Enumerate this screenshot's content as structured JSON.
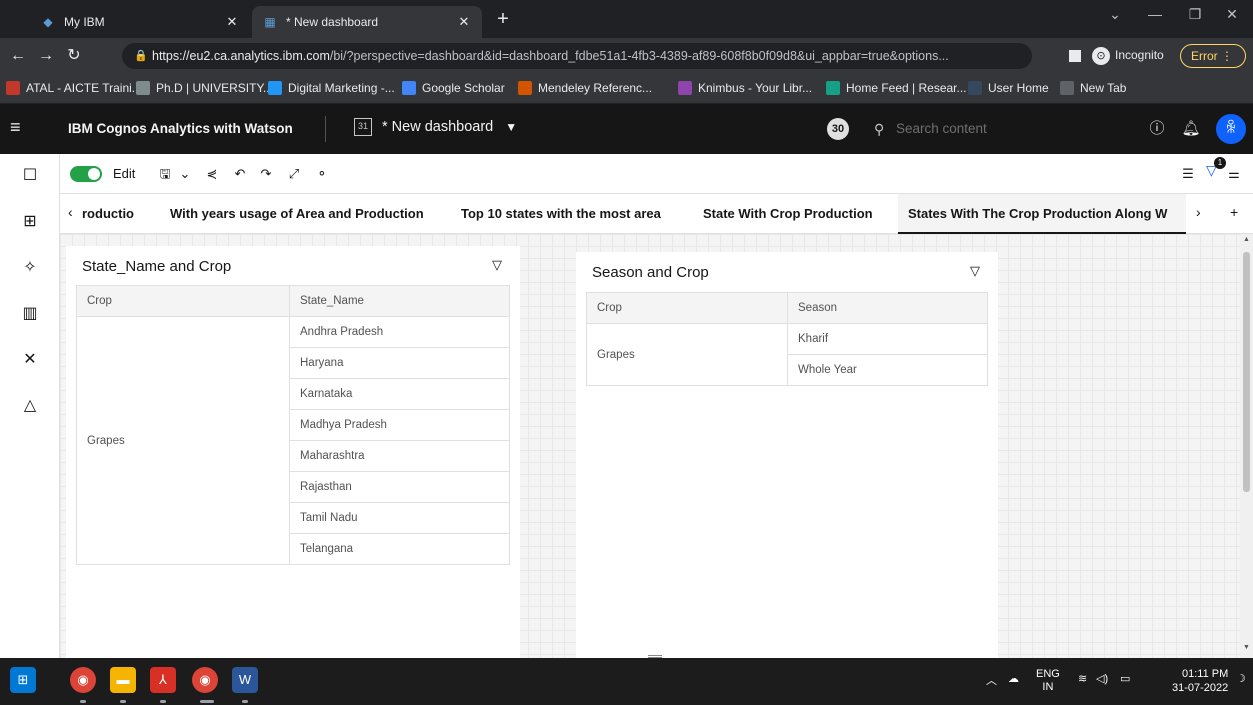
{
  "browser": {
    "tabs": [
      {
        "title": "My IBM",
        "active": false
      },
      {
        "title": "* New dashboard",
        "active": true
      }
    ],
    "new_tab_label": "+",
    "url_host": "https://eu2.ca.analytics.ibm.com",
    "url_rest": "/bi/?perspective=dashboard&id=dashboard_fdbe51a1-4fb3-4389-af89-608f8b0f09d8&ui_appbar=true&options...",
    "incognito_label": "Incognito",
    "error_label": "Error",
    "bookmarks": [
      {
        "label": "ATAL - AICTE Traini...",
        "icon": "atal-icon",
        "color": "#c0392b"
      },
      {
        "label": "Ph.D | UNIVERSITY...",
        "icon": "university-icon",
        "color": "#7f8c8d"
      },
      {
        "label": "Digital Marketing -...",
        "icon": "s-logo-icon",
        "color": "#2196f3"
      },
      {
        "label": "Google Scholar",
        "icon": "scholar-icon",
        "color": "#4285f4"
      },
      {
        "label": "Mendeley Referenc...",
        "icon": "mendeley-icon",
        "color": "#d35400"
      },
      {
        "label": "Knimbus - Your Libr...",
        "icon": "knimbus-icon",
        "color": "#8e44ad"
      },
      {
        "label": "Home Feed | Resear...",
        "icon": "researchgate-icon",
        "color": "#16a085"
      },
      {
        "label": "User Home",
        "icon": "ssrn-icon",
        "color": "#34495e"
      },
      {
        "label": "New Tab",
        "icon": "globe-icon",
        "color": "#5f6368"
      }
    ]
  },
  "appbar": {
    "product_name": "IBM Cognos Analytics with Watson",
    "dashboard_name": "* New dashboard",
    "notification_count": "30",
    "search_placeholder": "Search content"
  },
  "editbar": {
    "edit_label": "Edit",
    "filter_count": "1"
  },
  "dashboard_tabs": [
    {
      "label": "roductio",
      "active": false
    },
    {
      "label": "With years usage of Area and Production",
      "active": false
    },
    {
      "label": "Top 10 states with the most area",
      "active": false
    },
    {
      "label": "State With Crop Production",
      "active": false
    },
    {
      "label": "States With The Crop Production Along W",
      "active": true
    }
  ],
  "widgets": {
    "state_crop": {
      "title": "State_Name and Crop",
      "columns": [
        "Crop",
        "State_Name"
      ],
      "crop": "Grapes",
      "states": [
        "Andhra Pradesh",
        "Haryana",
        "Karnataka",
        "Madhya Pradesh",
        "Maharashtra",
        "Rajasthan",
        "Tamil Nadu",
        "Telangana"
      ]
    },
    "season_crop": {
      "title": "Season and Crop",
      "columns": [
        "Crop",
        "Season"
      ],
      "crop": "Grapes",
      "seasons": [
        "Kharif",
        "Whole Year"
      ]
    }
  },
  "taskbar": {
    "language": "ENG",
    "region": "IN",
    "time": "01:11 PM",
    "date": "31-07-2022"
  }
}
